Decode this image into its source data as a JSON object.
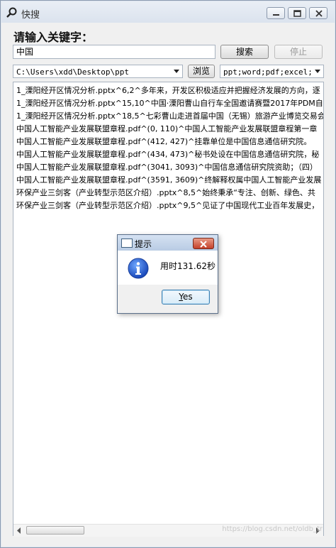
{
  "window": {
    "title": "快搜",
    "accent": "#dbe3ee"
  },
  "search": {
    "label": "请输入关键字：",
    "value": "中国",
    "search_button": "搜索",
    "stop_button": "停止"
  },
  "path": {
    "value": "C:\\Users\\xdd\\Desktop\\ppt",
    "browse_button": "浏览",
    "types_value": "ppt;word;pdf;excel;"
  },
  "results": [
    "1_溧阳经开区情况分析.pptx^6,2^多年来，开发区积极适应并把握经济发展的方向，逐",
    "1_溧阳经开区情况分析.pptx^15,10^中国·溧阳曹山自行车全国邀请赛暨2017年PDM自",
    "1_溧阳经开区情况分析.pptx^18,5^七彩曹山走进首届中国（无锡）旅游产业博览交易会",
    "中国人工智能产业发展联盟章程.pdf^(0, 110)^中国人工智能产业发展联盟章程第一章",
    "中国人工智能产业发展联盟章程.pdf^(412, 427)^挂靠单位是中国信息通信研究院。",
    "中国人工智能产业发展联盟章程.pdf^(434, 473)^秘书处设在中国信息通信研究院，秘",
    "中国人工智能产业发展联盟章程.pdf^(3041, 3093)^中国信息通信研究院资助；（四）",
    "中国人工智能产业发展联盟章程.pdf^(3591, 3609)^终解释权属中国人工智能产业发展",
    "环保产业三剑客（产业转型示范区介绍）.pptx^8,5^始终秉承“专注、创新、绿色、共",
    "环保产业三剑客（产业转型示范区介绍）.pptx^9,5^见证了中国现代工业百年发展史，"
  ],
  "watermark": "https://blog.csdn.net/oldb_tr",
  "dialog": {
    "title": "提示",
    "message": "用时131.62秒",
    "button_accel": "Y",
    "button_rest": "es",
    "icon": "info-icon"
  }
}
